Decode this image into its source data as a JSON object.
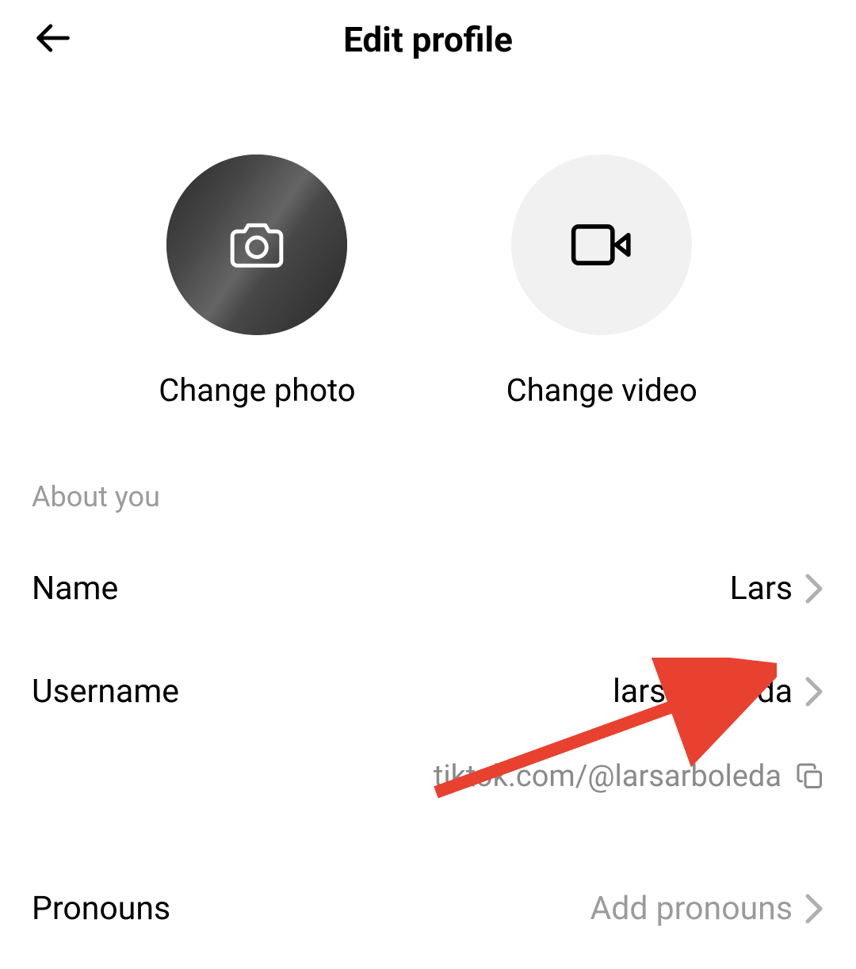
{
  "header": {
    "title": "Edit profile"
  },
  "media": {
    "photo_label": "Change photo",
    "video_label": "Change video"
  },
  "section": {
    "about_you": "About you"
  },
  "fields": {
    "name": {
      "label": "Name",
      "value": "Lars"
    },
    "username": {
      "label": "Username",
      "value": "larsarboleda",
      "url": "tiktok.com/@larsarboleda"
    },
    "pronouns": {
      "label": "Pronouns",
      "placeholder": "Add pronouns"
    }
  }
}
